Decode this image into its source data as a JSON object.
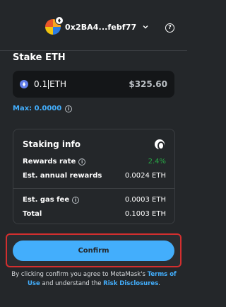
{
  "header": {
    "account_name": "0x2BA4...febf77",
    "avatar_icon": "account-avatar",
    "chevron_icon": "chevron-down-icon",
    "help_icon": "help-icon",
    "help_glyph": "?"
  },
  "stake": {
    "title": "Stake ETH",
    "amount_value": "0.1",
    "amount_unit": "ETH",
    "fiat_value": "$325.60",
    "max_label": "Max: 0.0000",
    "info_glyph": "i"
  },
  "staking_info": {
    "title": "Staking info",
    "rows": [
      {
        "label": "Rewards rate",
        "value": "2.4%",
        "has_info": true
      },
      {
        "label": "Est. annual rewards",
        "value": "0.0024 ETH",
        "has_info": false
      },
      {
        "label": "Est. gas fee",
        "value": "0.0003 ETH",
        "has_info": true
      },
      {
        "label": "Total",
        "value": "0.1003 ETH",
        "has_info": false
      }
    ]
  },
  "confirm": {
    "label": "Confirm"
  },
  "disclaimer": {
    "prefix": "By clicking confirm you agree to MetaMask's ",
    "terms_link": "Terms of Use",
    "middle": " and understand the ",
    "risk_link": "Risk Disclosures",
    "suffix": "."
  },
  "colors": {
    "background": "#24272a",
    "accent": "#43aefc",
    "positive": "#28a745",
    "highlight_border": "#d32f2f"
  }
}
